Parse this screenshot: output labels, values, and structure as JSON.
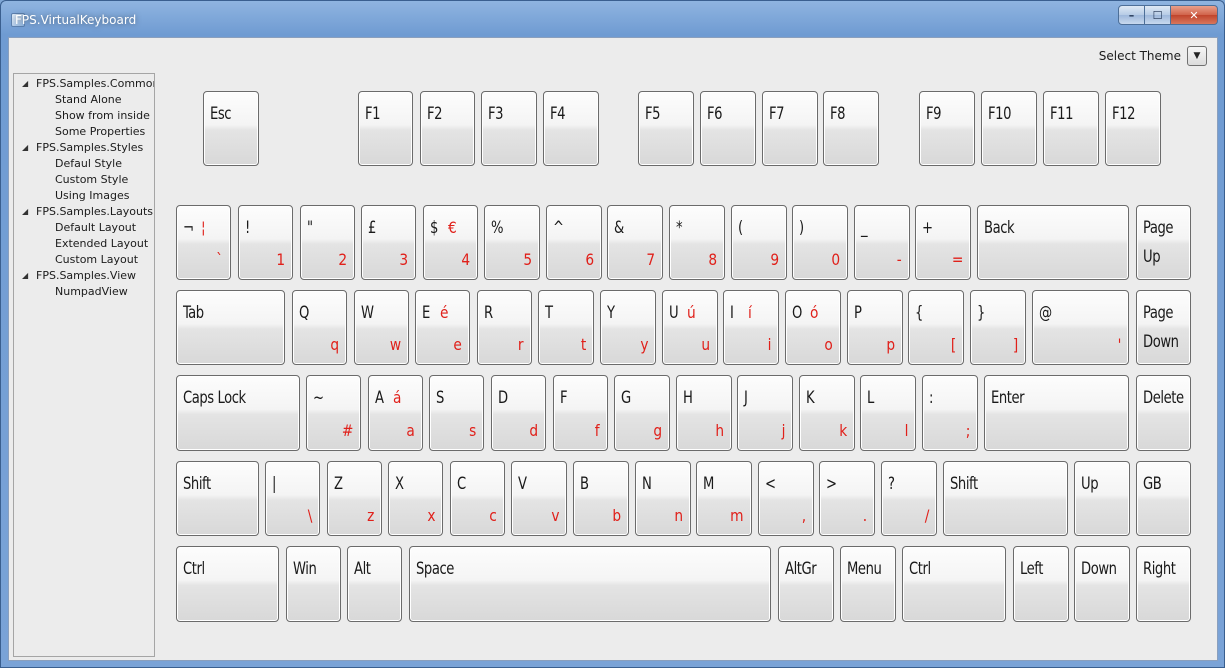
{
  "window": {
    "title": "FPS.VirtualKeyboard"
  },
  "caption": {
    "minimize": "–",
    "maximize": "☐",
    "close": "✕"
  },
  "theme": {
    "label": "Select Theme",
    "dropdown_icon": "▼"
  },
  "tree": [
    {
      "label": "FPS.Samples.Common",
      "children": [
        "Stand Alone",
        "Show from inside",
        "Some Properties"
      ]
    },
    {
      "label": "FPS.Samples.Styles",
      "children": [
        "Defaul Style",
        "Custom Style",
        "Using Images"
      ]
    },
    {
      "label": "FPS.Samples.Layouts",
      "children": [
        "Default Layout",
        "Extended Layout",
        "Custom Layout"
      ]
    },
    {
      "label": "FPS.Samples.View",
      "children": [
        "NumpadView"
      ]
    }
  ],
  "colors": {
    "secondary_label": "#e0201a",
    "primary_label": "#1a1a1a"
  },
  "keyboard": {
    "function_row": [
      {
        "p": "Esc"
      },
      {
        "p": "F1"
      },
      {
        "p": "F2"
      },
      {
        "p": "F3"
      },
      {
        "p": "F4"
      },
      {
        "p": "F5"
      },
      {
        "p": "F6"
      },
      {
        "p": "F7"
      },
      {
        "p": "F8"
      },
      {
        "p": "F9"
      },
      {
        "p": "F10"
      },
      {
        "p": "F11"
      },
      {
        "p": "F12"
      }
    ],
    "number_row": [
      {
        "p": "¬",
        "a": "¦",
        "s": "`"
      },
      {
        "p": "!",
        "s": "1"
      },
      {
        "p": "\"",
        "s": "2"
      },
      {
        "p": "£",
        "s": "3"
      },
      {
        "p": "$",
        "a": "€",
        "s": "4"
      },
      {
        "p": "%",
        "s": "5"
      },
      {
        "p": "^",
        "s": "6"
      },
      {
        "p": "&",
        "s": "7"
      },
      {
        "p": "*",
        "s": "8"
      },
      {
        "p": "(",
        "s": "9"
      },
      {
        "p": ")",
        "s": "0"
      },
      {
        "p": "_",
        "s": "-"
      },
      {
        "p": "+",
        "s": "="
      },
      {
        "p": "Back"
      },
      {
        "p": "Page",
        "p2": "Up"
      }
    ],
    "qwerty_row": [
      {
        "p": "Tab"
      },
      {
        "p": "Q",
        "s": "q"
      },
      {
        "p": "W",
        "s": "w"
      },
      {
        "p": "E",
        "a": "é",
        "s": "e"
      },
      {
        "p": "R",
        "s": "r"
      },
      {
        "p": "T",
        "s": "t"
      },
      {
        "p": "Y",
        "s": "y"
      },
      {
        "p": "U",
        "a": "ú",
        "s": "u"
      },
      {
        "p": "I",
        "a": "í",
        "s": "i"
      },
      {
        "p": "O",
        "a": "ó",
        "s": "o"
      },
      {
        "p": "P",
        "s": "p"
      },
      {
        "p": "{",
        "s": "["
      },
      {
        "p": "}",
        "s": "]"
      },
      {
        "p": "@",
        "s": "'"
      },
      {
        "p": "Page",
        "p2": "Down"
      }
    ],
    "home_row": [
      {
        "p": "Caps Lock"
      },
      {
        "p": "~",
        "s": "#"
      },
      {
        "p": "A",
        "a": "á",
        "s": "a"
      },
      {
        "p": "S",
        "s": "s"
      },
      {
        "p": "D",
        "s": "d"
      },
      {
        "p": "F",
        "s": "f"
      },
      {
        "p": "G",
        "s": "g"
      },
      {
        "p": "H",
        "s": "h"
      },
      {
        "p": "J",
        "s": "j"
      },
      {
        "p": "K",
        "s": "k"
      },
      {
        "p": "L",
        "s": "l"
      },
      {
        "p": ":",
        "s": ";"
      },
      {
        "p": "Enter"
      },
      {
        "p": "Delete"
      }
    ],
    "shift_row": [
      {
        "p": "Shift"
      },
      {
        "p": "|",
        "s": "\\"
      },
      {
        "p": "Z",
        "s": "z"
      },
      {
        "p": "X",
        "s": "x"
      },
      {
        "p": "C",
        "s": "c"
      },
      {
        "p": "V",
        "s": "v"
      },
      {
        "p": "B",
        "s": "b"
      },
      {
        "p": "N",
        "s": "n"
      },
      {
        "p": "M",
        "s": "m"
      },
      {
        "p": "<",
        "s": ","
      },
      {
        "p": ">",
        "s": "."
      },
      {
        "p": "?",
        "s": "/"
      },
      {
        "p": "Shift"
      },
      {
        "p": "Up"
      },
      {
        "p": "GB"
      }
    ],
    "bottom_row": [
      {
        "p": "Ctrl"
      },
      {
        "p": "Win"
      },
      {
        "p": "Alt"
      },
      {
        "p": "Space"
      },
      {
        "p": "AltGr"
      },
      {
        "p": "Menu"
      },
      {
        "p": "Ctrl"
      },
      {
        "p": "Left"
      },
      {
        "p": "Down"
      },
      {
        "p": "Right"
      }
    ]
  }
}
